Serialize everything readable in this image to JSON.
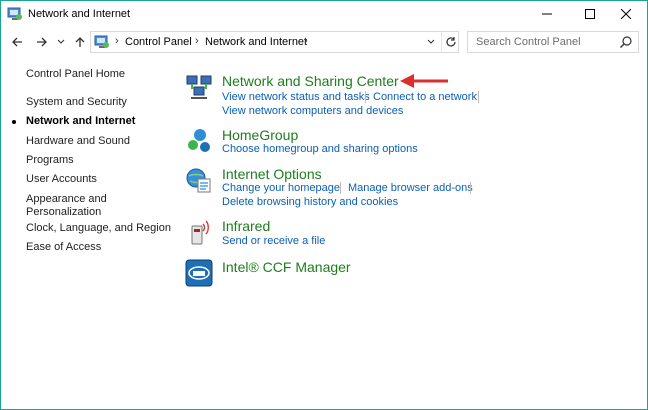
{
  "window": {
    "title": "Network and Internet",
    "accent_color": "#1aa590"
  },
  "nav": {
    "breadcrumbs": [
      "Control Panel",
      "Network and Internet"
    ],
    "search_placeholder": "Search Control Panel"
  },
  "sidebar": {
    "items": [
      {
        "label": "Control Panel Home",
        "current": false
      },
      {
        "label": "System and Security",
        "current": false
      },
      {
        "label": "Network and Internet",
        "current": true
      },
      {
        "label": "Hardware and Sound",
        "current": false
      },
      {
        "label": "Programs",
        "current": false
      },
      {
        "label": "User Accounts",
        "current": false
      },
      {
        "label": "Appearance and",
        "current": false
      },
      {
        "label": "Personalization",
        "current": false
      },
      {
        "label": "Clock, Language, and Region",
        "current": false
      },
      {
        "label": "Ease of Access",
        "current": false
      }
    ]
  },
  "categories": [
    {
      "title": "Network and Sharing Center",
      "icon": "network-icon",
      "tasks": [
        "View network status and tasks",
        "Connect to a network",
        "View network computers and devices"
      ]
    },
    {
      "title": "HomeGroup",
      "icon": "homegroup-icon",
      "tasks": [
        "Choose homegroup and sharing options"
      ]
    },
    {
      "title": "Internet Options",
      "icon": "internet-options-icon",
      "tasks": [
        "Change your homepage",
        "Manage browser add-ons",
        "Delete browsing history and cookies"
      ]
    },
    {
      "title": "Infrared",
      "icon": "infrared-icon",
      "tasks": [
        "Send or receive a file"
      ]
    },
    {
      "title": "Intel® CCF Manager",
      "icon": "intel-icon",
      "tasks": []
    }
  ],
  "colors": {
    "category_title": "#1e7d1e",
    "task_link": "#0b5fb5",
    "annotation_arrow": "#d9302c"
  }
}
